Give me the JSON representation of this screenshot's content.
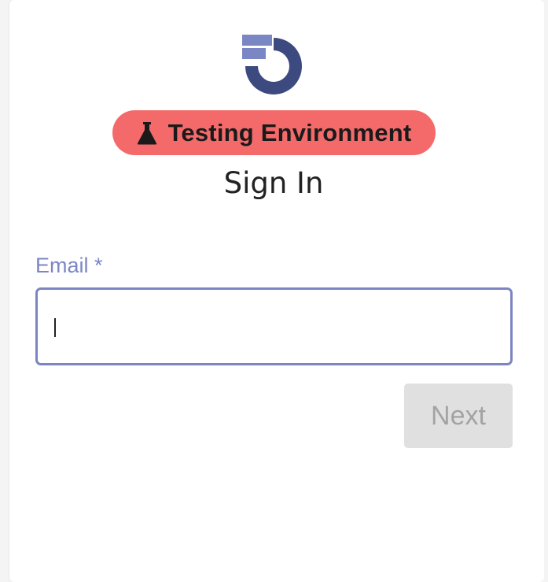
{
  "badge": {
    "label": "Testing Environment",
    "icon": "flask-icon",
    "color": "#f46a6a"
  },
  "logo": {
    "icon": "app-logo",
    "colors": [
      "#3c4a80",
      "#7b86c4"
    ]
  },
  "page": {
    "title": "Sign In"
  },
  "form": {
    "email_label": "Email *",
    "email_value": "",
    "focus_color": "#7c85c2"
  },
  "actions": {
    "next_label": "Next",
    "next_enabled": false
  }
}
